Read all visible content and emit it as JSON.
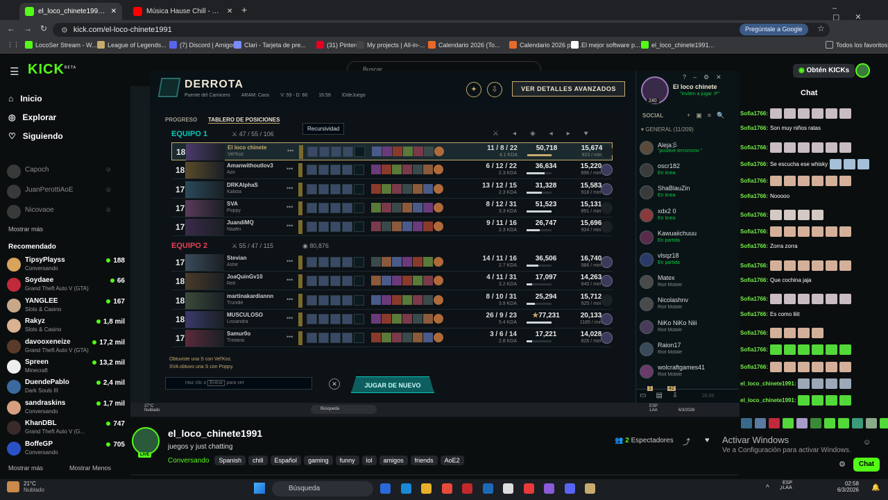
{
  "browser": {
    "tabs": [
      {
        "title": "el_loco_chinete1991 Stream"
      },
      {
        "title": "Música Hause Chill - SIN CO"
      }
    ],
    "url": "kick.com/el-loco-chinete1991",
    "google_button": "Pregúntale a Google",
    "bookmarks": [
      "LocoSer Stream - W...",
      "League of Legends...",
      "(7) Discord | Amigos",
      "Clari - Tarjeta de pre...",
      "(31) Pinterest",
      "My projects | All-in-...",
      "Calendario 2026 (To...",
      "Calendario 2026 par...",
      "El mejor software p...",
      "el_loco_chinete1991..."
    ],
    "all_bookmarks": "Todos los favoritos"
  },
  "kick": {
    "logo": "KICK",
    "beta": "BETA",
    "search_placeholder": "Buscar",
    "get_kicks": "Obtén KICKs",
    "nav": [
      "Inicio",
      "Explorar",
      "Siguiendo"
    ],
    "following": [
      {
        "name": "Capoch"
      },
      {
        "name": "JuanPerottiAoE"
      },
      {
        "name": "Nicovaoe"
      }
    ],
    "show_more": "Mostrar más",
    "recommended_title": "Recomendado",
    "recommended": [
      {
        "name": "TipsyPlayss",
        "cat": "Conversando",
        "viewers": "188",
        "color": "#d8a35a"
      },
      {
        "name": "Soydaee",
        "cat": "Grand Theft Auto V (GTA)",
        "viewers": "66",
        "color": "#c02a3a"
      },
      {
        "name": "YANGLEE",
        "cat": "Slots & Casino",
        "viewers": "167",
        "color": "#c9a88a"
      },
      {
        "name": "Rakyz",
        "cat": "Slots & Casino",
        "viewers": "1,8 mil",
        "color": "#d9b292"
      },
      {
        "name": "davooxeneize",
        "cat": "Grand Theft Auto V (GTA)",
        "viewers": "17,2 mil",
        "color": "#5a3a2a"
      },
      {
        "name": "Spreen",
        "cat": "Minecraft",
        "viewers": "13,2 mil",
        "color": "#eeeeee"
      },
      {
        "name": "DuendePablo",
        "cat": "Dark Souls III",
        "viewers": "2,4 mil",
        "color": "#3a6aa0"
      },
      {
        "name": "sandraskins",
        "cat": "Conversando",
        "viewers": "1,7 mil",
        "color": "#d6a080"
      },
      {
        "name": "KhanDBL",
        "cat": "Grand Theft Auto V (G...",
        "viewers": "747",
        "color": "#3a2a2a"
      },
      {
        "name": "BoffeGP",
        "cat": "Conversando",
        "viewers": "705",
        "color": "#2a52c8"
      }
    ],
    "show_more_footer": "Mostrar más",
    "show_less": "Mostrar Menos",
    "chat_title": "Chat",
    "streamer": "el_loco_chinete1991",
    "stream_title": "juegos y just chatting",
    "live": "LIVE",
    "category": "Conversando",
    "tags": [
      "Spanish",
      "chill",
      "Español",
      "gaming",
      "funny",
      "lol",
      "amigos",
      "friends",
      "AoE2"
    ],
    "viewers_count": "2",
    "viewers_label": "Espectadores",
    "chat_button": "Chat",
    "activate_title": "Activar Windows",
    "activate_sub": "Ve a Configuración para activar Windows."
  },
  "chat": [
    {
      "user": "Sofia1766:",
      "text": "",
      "emotes": 6,
      "color": "#c9bcc4"
    },
    {
      "user": "Sofia1766:",
      "text": "Son muy niños ratas",
      "emotes": 0
    },
    {
      "user": "Sofia1766:",
      "text": "",
      "emotes": 6,
      "color": "#c9bcc4"
    },
    {
      "user": "Sofia1766:",
      "text": "Se escucha ese whisky",
      "emotes": 3,
      "color": "#a3c0d8"
    },
    {
      "user": "Sofia1766:",
      "text": "",
      "emotes": 6,
      "color": "#d4b09a"
    },
    {
      "user": "Sofia1766:",
      "text": "Nooooo",
      "emotes": 0
    },
    {
      "user": "Sofia1766:",
      "text": "",
      "emotes": 4,
      "color": "#d4c9c4"
    },
    {
      "user": "Sofia1766:",
      "text": "",
      "emotes": 6,
      "color": "#d4b09a"
    },
    {
      "user": "Sofia1766:",
      "text": "Zorra zorra",
      "emotes": 0
    },
    {
      "user": "Sofia1766:",
      "text": "",
      "emotes": 6,
      "color": "#d4b09a"
    },
    {
      "user": "Sofia1766:",
      "text": "Que cochina jaja",
      "emotes": 0
    },
    {
      "user": "Sofia1766:",
      "text": "",
      "emotes": 6,
      "color": "#c9bcc4"
    },
    {
      "user": "Sofia1766:",
      "text": "Es como liiit",
      "emotes": 0
    },
    {
      "user": "Sofia1766:",
      "text": "",
      "emotes": 4,
      "color": "#d4b09a"
    },
    {
      "user": "Sofia1766:",
      "text": "",
      "emotes": 6,
      "color": "#53d83a"
    },
    {
      "user": "Sofia1766:",
      "text": "",
      "emotes": 6,
      "color": "#d4b09a"
    },
    {
      "user": "el_loco_chinete1991:",
      "text": "",
      "emotes": 4,
      "color": "#9aa8b8"
    },
    {
      "user": "el_loco_chinete1991:",
      "text": "",
      "emotes": 4,
      "color": "#53d83a"
    }
  ],
  "lol": {
    "result": "DERROTA",
    "map": "Puente del Carnicero",
    "mode": "ARAM: Caos",
    "record": "V: 59 - D: 66",
    "time": "16:59",
    "game_id": "IDdeJuego",
    "advanced_btn": "VER DETALLES AVANZADOS",
    "tab_progress": "PROGRESO",
    "tab_scoreboard": "TABLERO DE POSICIONES",
    "tooltip": "Recursividad",
    "team1": {
      "label": "EQUIPO 1",
      "kda": "47 / 55 / 106"
    },
    "team2": {
      "label": "EQUIPO 2",
      "kda": "55 / 47 / 115",
      "gold": "80,876"
    },
    "players": [
      {
        "lvl": "18",
        "name": "El loco chinete",
        "champ": "Vel'Koz",
        "kda": "11 / 8 / 22",
        "ratio": "4.1 KDA",
        "dmg": "50,718",
        "dmgf": 0.98,
        "gold": "15,674",
        "gpm": "923 / min",
        "me": true
      },
      {
        "lvl": "18",
        "name": "Amanwithoutlov3",
        "champ": "Azir",
        "kda": "6 / 12 / 22",
        "ratio": "2.3 KDA",
        "dmg": "36,634",
        "dmgf": 0.71,
        "gold": "15,220",
        "gpm": "896 / min"
      },
      {
        "lvl": "17",
        "name": "DRKAlphaS",
        "champ": "Kalista",
        "kda": "13 / 12 / 15",
        "ratio": "2.3 KDA",
        "dmg": "31,328",
        "dmgf": 0.61,
        "gold": "15,583",
        "gpm": "918 / min"
      },
      {
        "lvl": "17",
        "name": "SVA",
        "champ": "Poppy",
        "kda": "8 / 12 / 31",
        "ratio": "3.3 KDA",
        "dmg": "51,523",
        "dmgf": 1.0,
        "gold": "15,131",
        "gpm": "891 / min"
      },
      {
        "lvl": "17",
        "name": "JuandiMQ",
        "champ": "Naafiri",
        "kda": "9 / 11 / 16",
        "ratio": "2.3 KDA",
        "dmg": "26,747",
        "dmgf": 0.52,
        "gold": "15,696",
        "gpm": "924 / min"
      },
      {
        "lvl": "17",
        "name": "Stevian",
        "champ": "Ashe",
        "kda": "14 / 11 / 16",
        "ratio": "2.7 KDA",
        "dmg": "36,506",
        "dmgf": 0.47,
        "gold": "16,740",
        "gpm": "986 / min"
      },
      {
        "lvl": "18",
        "name": "JoaQuinGv10",
        "champ": "Rell",
        "kda": "4 / 11 / 31",
        "ratio": "3.2 KDA",
        "dmg": "17,097",
        "dmgf": 0.22,
        "gold": "14,263",
        "gpm": "840 / min"
      },
      {
        "lvl": "18",
        "name": "martinakardiannn",
        "champ": "Trundle",
        "kda": "8 / 10 / 31",
        "ratio": "3.9 KDA",
        "dmg": "25,294",
        "dmgf": 0.33,
        "gold": "15,712",
        "gpm": "925 / min"
      },
      {
        "lvl": "18",
        "name": "MUSCULOSO",
        "champ": "Lissandra",
        "kda": "26 / 9 / 23",
        "ratio": "5.4 KDA",
        "dmg": "77,231",
        "dmgf": 1.0,
        "gold": "20,133",
        "gpm": "1185 / min",
        "star": "★"
      },
      {
        "lvl": "17",
        "name": "Samur0o",
        "champ": "Tristana",
        "kda": "3 / 6 / 14",
        "ratio": "2.8 KDA",
        "dmg": "17,221",
        "dmgf": 0.22,
        "gold": "14,028",
        "gpm": "826 / min"
      }
    ],
    "s_rank_1": "Obtuviste una S con Vel'Koz.",
    "s_rank_2": "SVA obtuvo una S con Poppy.",
    "chat_placeholder": "Haz clic o",
    "chat_key": "Entrar",
    "chat_after": "para ver",
    "play_again": "JUGAR DE NUEVO",
    "profile": {
      "name": "El loco chinete",
      "status": "\"inviten a jugar :P\"",
      "level": "240"
    },
    "social": "SOCIAL",
    "group": "GENERAL (11/209)",
    "friends": [
      {
        "name": "Aleja彡",
        "status": "\"positive terrorismo \"",
        "green": true
      },
      {
        "name": "oscr182",
        "status": "En línea",
        "green": true
      },
      {
        "name": "ShaBlauZin",
        "status": "En línea",
        "green": true
      },
      {
        "name": "xdx2 0",
        "status": "En línea",
        "green": true
      },
      {
        "name": "Kawuaiichuuu",
        "status": "En partida",
        "green": true
      },
      {
        "name": "vlsqz18",
        "status": "En partida",
        "green": true
      },
      {
        "name": "Matex",
        "status": "Riot Mobile"
      },
      {
        "name": "Nicolashnv",
        "status": "Riot Mobile"
      },
      {
        "name": "NiKo NiKo Niii",
        "status": "Riot Mobile"
      },
      {
        "name": "Raion17",
        "status": "Riot Mobile"
      },
      {
        "name": "wolcraftgames41",
        "status": "Riot Mobile"
      }
    ],
    "badge1": "1",
    "badge2": "42",
    "version": "26.05"
  },
  "inner_taskbar": {
    "temp": "27°C",
    "weather": "Nublado",
    "search": "Búsqueda",
    "lang": "ESP",
    "region": "LAA",
    "date": "6/3/2026"
  },
  "taskbar": {
    "temp": "21°C",
    "weather": "Nublado",
    "search": "Búsqueda",
    "lang": "ESP",
    "region": "LAA",
    "time": "02:58",
    "date": "6/3/2026"
  }
}
